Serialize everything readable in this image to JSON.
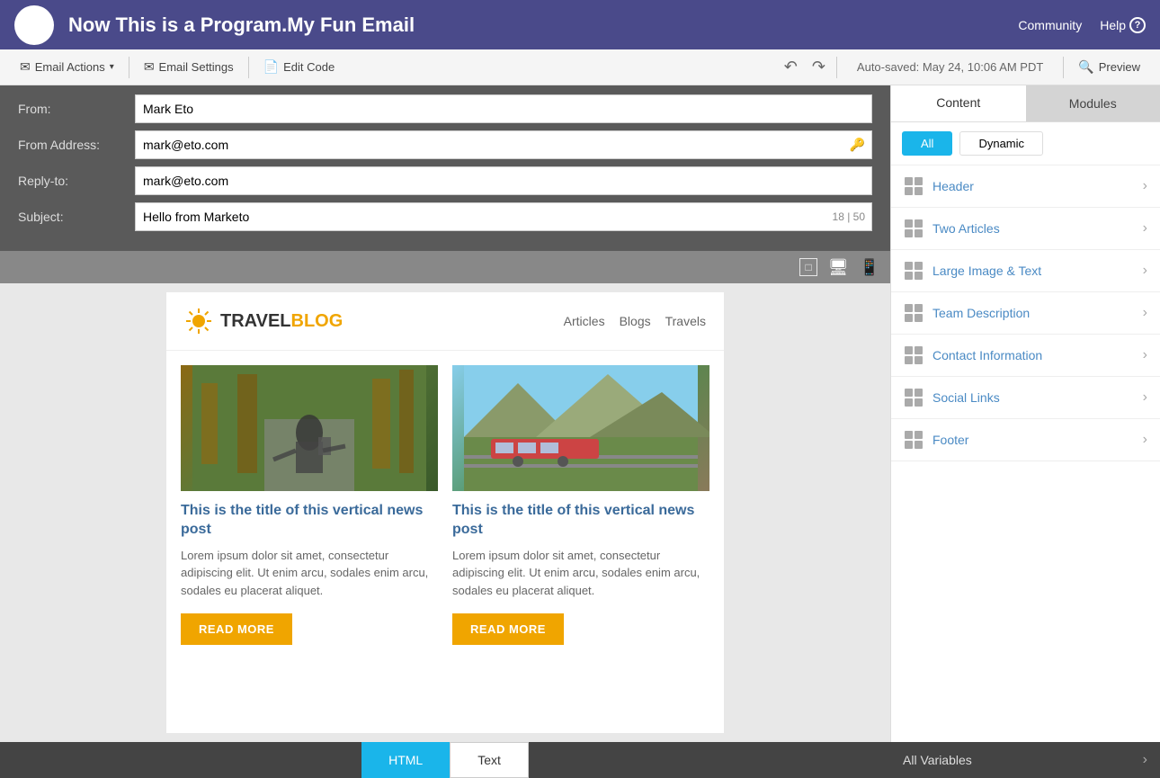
{
  "app": {
    "title": "Now This is a Program.My Fun Email",
    "nav": {
      "community": "Community",
      "help": "Help"
    }
  },
  "toolbar": {
    "email_actions": "Email Actions",
    "email_settings": "Email Settings",
    "edit_code": "Edit Code",
    "auto_saved": "Auto-saved: May 24, 10:06 AM PDT",
    "preview": "Preview"
  },
  "email_form": {
    "from_label": "From:",
    "from_value": "Mark Eto",
    "from_address_label": "From Address:",
    "from_address_value": "mark@eto.com",
    "reply_to_label": "Reply-to:",
    "reply_to_value": "mark@eto.com",
    "subject_label": "Subject:",
    "subject_value": "Hello from Marketo",
    "subject_count": "18 | 50"
  },
  "email_preview": {
    "blog_name": "TRAVEL",
    "blog_name_accent": "BLOG",
    "nav_items": [
      "Articles",
      "Blogs",
      "Travels"
    ],
    "articles": [
      {
        "title": "This is the title of this vertical news post",
        "body": "Lorem ipsum dolor sit amet, consectetur adipiscing elit. Ut enim arcu, sodales enim arcu, sodales eu placerat aliquet.",
        "read_more": "READ MORE"
      },
      {
        "title": "This is the title of this vertical news post",
        "body": "Lorem ipsum dolor sit amet, consectetur adipiscing elit. Ut enim arcu, sodales enim arcu, sodales eu placerat aliquet.",
        "read_more": "READ MORE"
      }
    ]
  },
  "right_panel": {
    "tab_content": "Content",
    "tab_modules": "Modules",
    "filter_all": "All",
    "filter_dynamic": "Dynamic",
    "modules": [
      {
        "name": "Header"
      },
      {
        "name": "Two Articles"
      },
      {
        "name": "Large Image & Text"
      },
      {
        "name": "Team Description"
      },
      {
        "name": "Contact Information"
      },
      {
        "name": "Social Links"
      },
      {
        "name": "Footer"
      }
    ]
  },
  "bottom_bar": {
    "tab_html": "HTML",
    "tab_text": "Text",
    "all_variables": "All Variables"
  }
}
